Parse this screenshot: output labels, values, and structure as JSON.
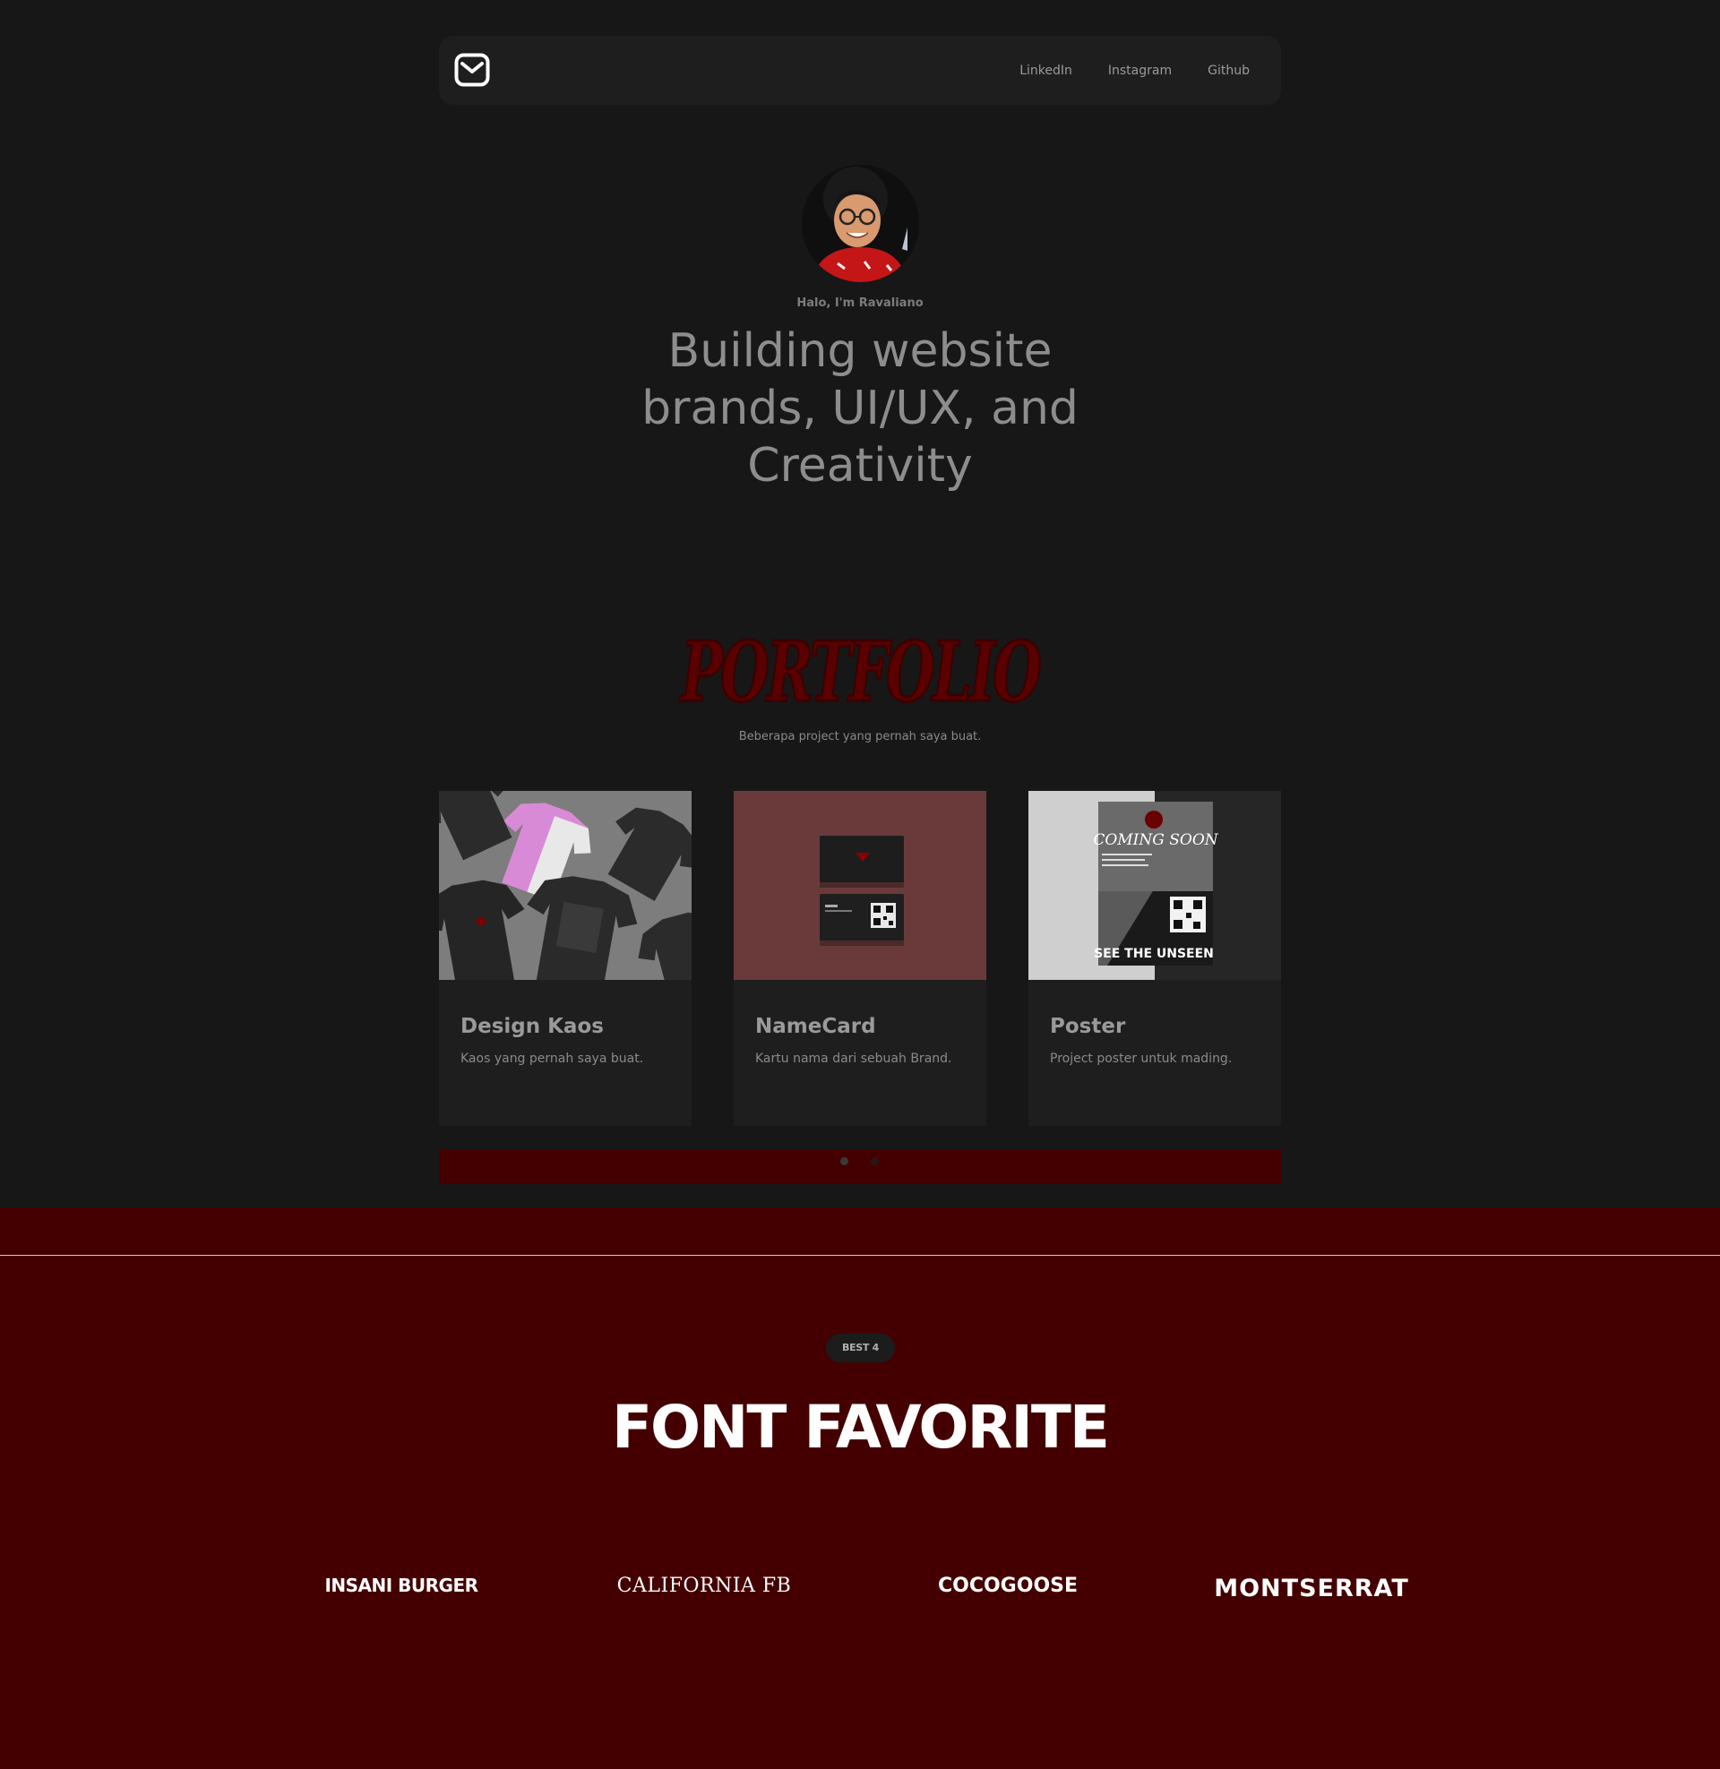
{
  "nav": {
    "logo_icon": "mail-icon",
    "links": [
      "LinkedIn",
      "Instagram",
      "Github"
    ]
  },
  "hero": {
    "greeting": "Halo, I'm Ravaliano",
    "headline": "Building website brands, UI/UX, and Creativity"
  },
  "portfolio": {
    "title": "PORTFOLIO",
    "subtitle": "Beberapa project yang pernah saya buat.",
    "cards": [
      {
        "title": "Design Kaos",
        "desc": "Kaos yang pernah saya buat."
      },
      {
        "title": "NameCard",
        "desc": "Kartu nama dari sebuah Brand."
      },
      {
        "title": "Poster",
        "desc": "Project poster untuk mading.",
        "poster_top": "COMING SOON",
        "poster_bottom": "SEE THE UNSEEN"
      }
    ],
    "pagination": {
      "pages": 2,
      "active": 1
    }
  },
  "fonts": {
    "badge": "BEST 4",
    "title": "FONT FAVORITE",
    "items": [
      "INSANI BURGER",
      "CALIFORNIA FB",
      "COCOGOOSE",
      "MONTSERRAT"
    ]
  },
  "colors": {
    "background": "#171717",
    "accent": "#440000",
    "portfolio_title": "#5a0000"
  }
}
